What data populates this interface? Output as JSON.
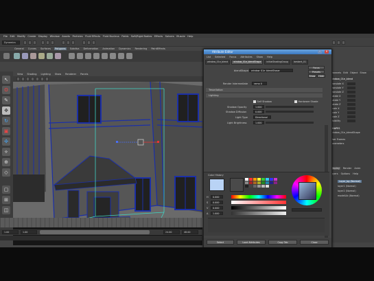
{
  "app": {
    "title": "Attribute Editor"
  },
  "menubar": {
    "items": [
      "File",
      "Edit",
      "Modify",
      "Create",
      "Display",
      "Window",
      "Assets",
      "Particles",
      "Fluid Effects",
      "Fluid Nucleus",
      "Fields",
      "Soft/Rigid Bodies",
      "Effects",
      "Solvers",
      "Muscle",
      "Help"
    ]
  },
  "statusline": {
    "mode": "Dynamics"
  },
  "shelf": {
    "tabs": [
      "General",
      "Curves",
      "Surfaces",
      "Polygons",
      "Subdivs",
      "Deformation",
      "Animation",
      "Dynamics",
      "Rendering",
      "PaintEffects"
    ],
    "active_tab": "Polygons"
  },
  "panel": {
    "menus": [
      "View",
      "Shading",
      "Lighting",
      "Show",
      "Renderer",
      "Panels"
    ]
  },
  "attribute_editor": {
    "title": "Attribute Editor",
    "menus": [
      "List",
      "Selected",
      "Focus",
      "Attributes",
      "Show",
      "Help"
    ],
    "tabs": [
      "window_01e_blend",
      "window_01e_blendShape",
      "initialShadingGroup",
      "lambert_01"
    ],
    "active_tab": "window_01e_blendShape",
    "node_label": "blendShape:",
    "node_value": "window_01e_blendShape",
    "focus_button": "Focus",
    "presets_button": "Presets",
    "show_button": "Show",
    "hide_button": "Hide",
    "render_label": "Render Intermediate",
    "render_value": "ramp 0",
    "sections": {
      "shape": "Tessellation",
      "lighting": "Lighting"
    },
    "lighting": {
      "self_shadow_label": "Self Shadow",
      "hardware_shade_label": "Hardware Shade",
      "shadow_opacity_label": "Shadow Opacity",
      "shadow_opacity_value": "1.000",
      "shadow_diffusion_label": "Shadow Diffusion",
      "shadow_diffusion_value": "0.000",
      "light_type_label": "Light Type",
      "light_type_value": "Directional",
      "light_brightness_label": "Light Brightness",
      "light_brightness_value": "1.000"
    },
    "color_editor": {
      "title": "Color History",
      "r_label": "H",
      "r_value": "0.000",
      "g_label": "S",
      "g_value": "0.000",
      "b_label": "V",
      "b_value": "0.000",
      "a_label": "A",
      "a_value": "1.000"
    },
    "bottom": {
      "select_button": "Select",
      "load_button": "Load Attributes",
      "copy_button": "Copy Tab",
      "close_button": "Close"
    }
  },
  "channel_box": {
    "tabs": [
      "Channels",
      "Edit",
      "Object",
      "Show"
    ],
    "node": "window_01e_blend",
    "channels": [
      {
        "label": "Translate X",
        "value": "0"
      },
      {
        "label": "Translate Y",
        "value": "0"
      },
      {
        "label": "Translate Z",
        "value": "0"
      },
      {
        "label": "Rotate X",
        "value": "0"
      },
      {
        "label": "Rotate Y",
        "value": "0"
      },
      {
        "label": "Rotate Z",
        "value": "0"
      },
      {
        "label": "Scale X",
        "value": "1"
      },
      {
        "label": "Scale Y",
        "value": "1"
      },
      {
        "label": "Scale Z",
        "value": "1"
      },
      {
        "label": "Visibility",
        "value": "on"
      }
    ],
    "shapes_label": "SHAPES",
    "shape_name": "window_01e_blendShape",
    "inputs": [
      "User Frames",
      "Parameters"
    ],
    "layer_tabs": [
      "Display",
      "Render",
      "Anim"
    ],
    "layer_menus": [
      "Layers",
      "Options",
      "Help"
    ],
    "layers": [
      "Layer_bg (Normal)",
      "layer1 (Normal)",
      "layer2 (Normal)",
      "modelLib (Normal)"
    ]
  },
  "timeline": {
    "start": "1.00",
    "end": "24.00",
    "range_start": "1.00",
    "range_end": "48.00",
    "anim_layer": "No Anim Layer",
    "char_set": "No Character Set"
  },
  "colors": {
    "titlebar": "#3b78c0",
    "active_tab": "#5d6f7f",
    "wire": "#1b2fa8",
    "sky": "#6b6b6b"
  }
}
